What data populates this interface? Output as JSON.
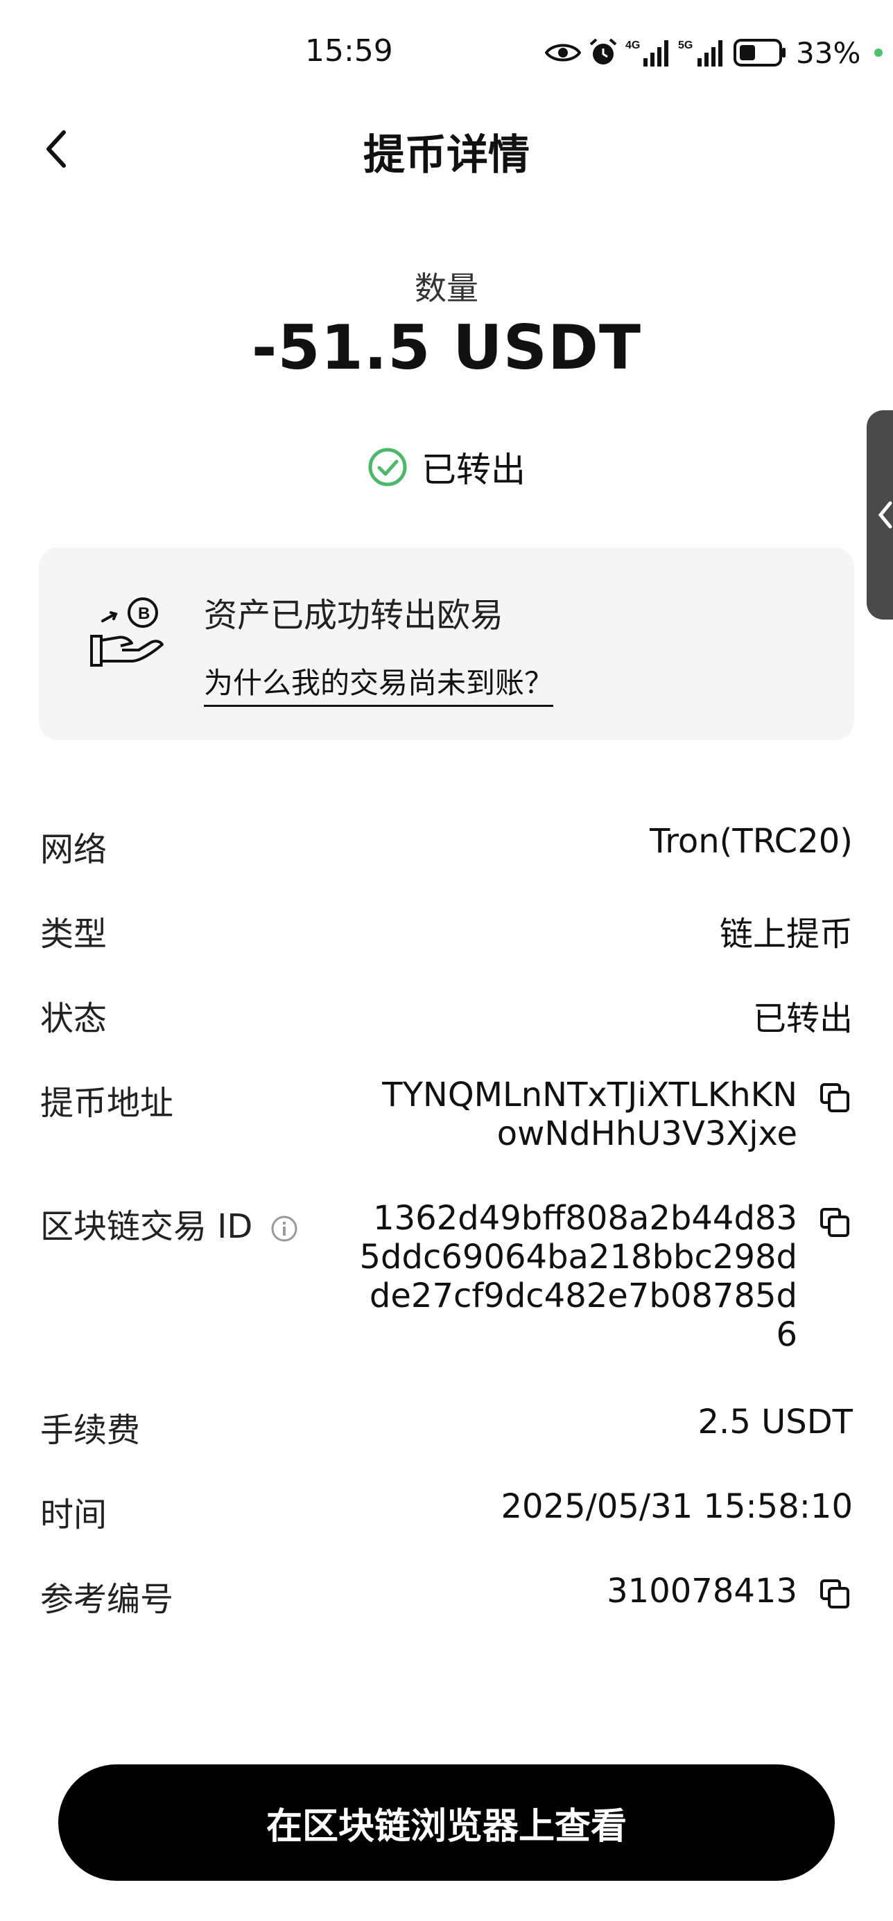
{
  "status_bar": {
    "time": "15:59",
    "battery": "33%",
    "signal_1": "4G",
    "signal_2": "5G",
    "icons": [
      "eye-icon",
      "alarm-icon",
      "signal-4g-icon",
      "signal-5g-icon",
      "battery-icon"
    ]
  },
  "header": {
    "title": "提币详情"
  },
  "amount": {
    "label": "数量",
    "value": "-51.5 USDT"
  },
  "status": {
    "text": "已转出",
    "color": "#4cb86a"
  },
  "notice": {
    "title": "资产已成功转出欧易",
    "link": "为什么我的交易尚未到账？"
  },
  "details": {
    "network": {
      "label": "网络",
      "value": "Tron(TRC20)"
    },
    "type": {
      "label": "类型",
      "value": "链上提币"
    },
    "state": {
      "label": "状态",
      "value": "已转出"
    },
    "address": {
      "label": "提币地址",
      "line1": "TYNQMLnNTxTJiXTLKhKN",
      "line2": "owNdHhU3V3Xjxe"
    },
    "txid": {
      "label": "区块链交易 ID",
      "line1": "1362d49bff808a2b44d83",
      "line2": "5ddc69064ba218bbc298d",
      "line3": "de27cf9dc482e7b08785d",
      "line4": "6"
    },
    "fee": {
      "label": "手续费",
      "value": "2.5 USDT"
    },
    "time": {
      "label": "时间",
      "value": "2025/05/31 15:58:10"
    },
    "ref": {
      "label": "参考编号",
      "value": "310078413"
    }
  },
  "footer": {
    "button": "在区块链浏览器上查看"
  }
}
